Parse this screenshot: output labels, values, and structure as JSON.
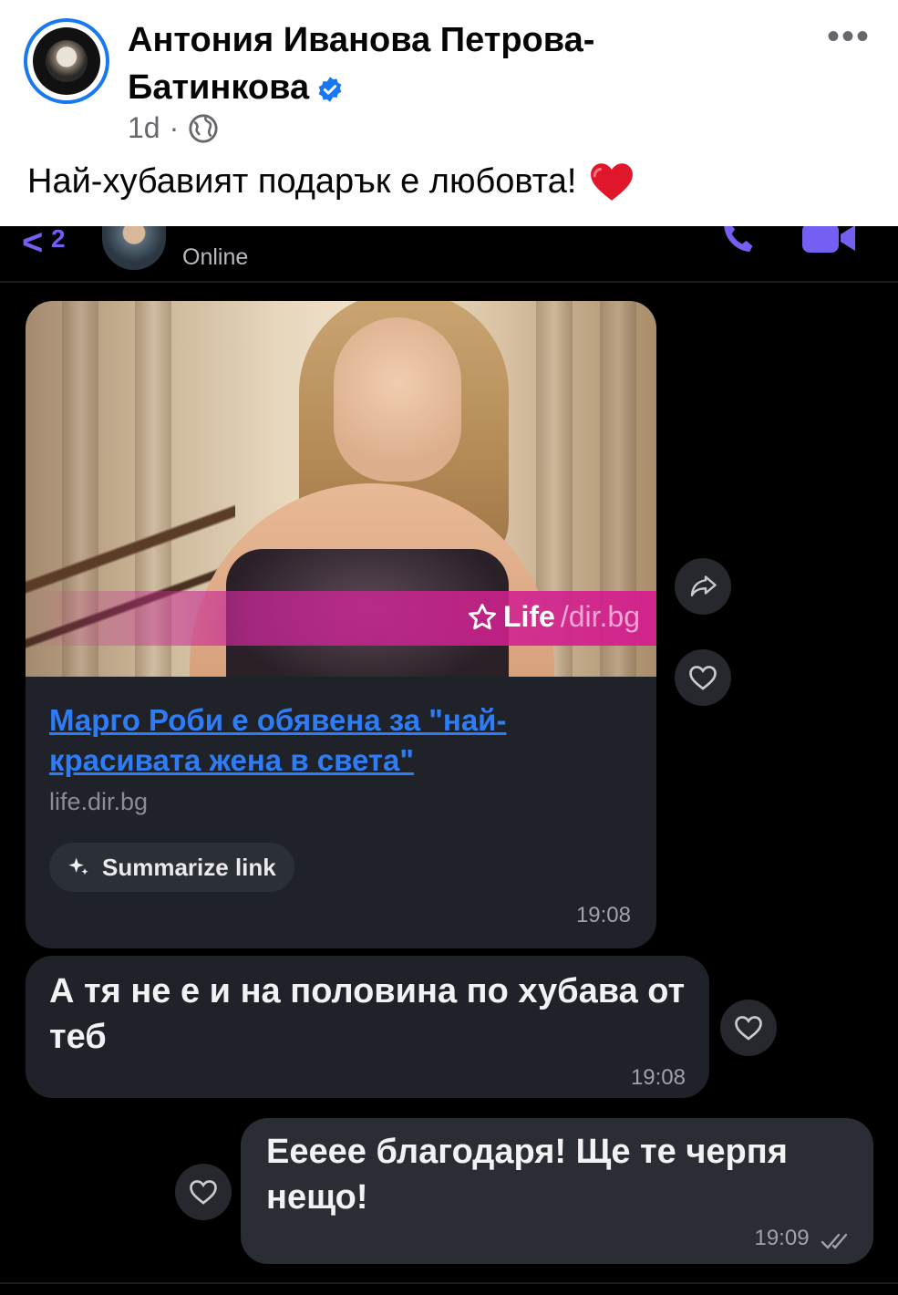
{
  "post": {
    "author": "Антония Иванова Петрова-Батинкова",
    "time": "1d",
    "separator": "·",
    "privacy_icon": "globe-icon",
    "caption": "Най-хубавият подарък е любовта!",
    "caption_emoji": "red-heart-emoji",
    "more_label": "•••"
  },
  "chat": {
    "header": {
      "back_label": "<",
      "unread_count": "2",
      "contact_status": "Online"
    },
    "link_message": {
      "brand_name": "Life",
      "brand_suffix": "/dir.bg",
      "title": "Марго Роби е обявена за \"най-красивата жена в света\"",
      "domain": "life.dir.bg",
      "summarize_label": "Summarize link",
      "time": "19:08"
    },
    "message_2": {
      "text": "А тя не е и на половина по хубава от теб",
      "time": "19:08"
    },
    "message_3": {
      "text": "Ееeee благодаря! Ще те черпя нещо!",
      "time": "19:09"
    }
  },
  "colors": {
    "facebook_blue": "#1877f2",
    "viber_purple": "#7360f2",
    "link_blue": "#2f7df6",
    "chat_background": "#000000",
    "bubble_background": "#1f2228"
  }
}
